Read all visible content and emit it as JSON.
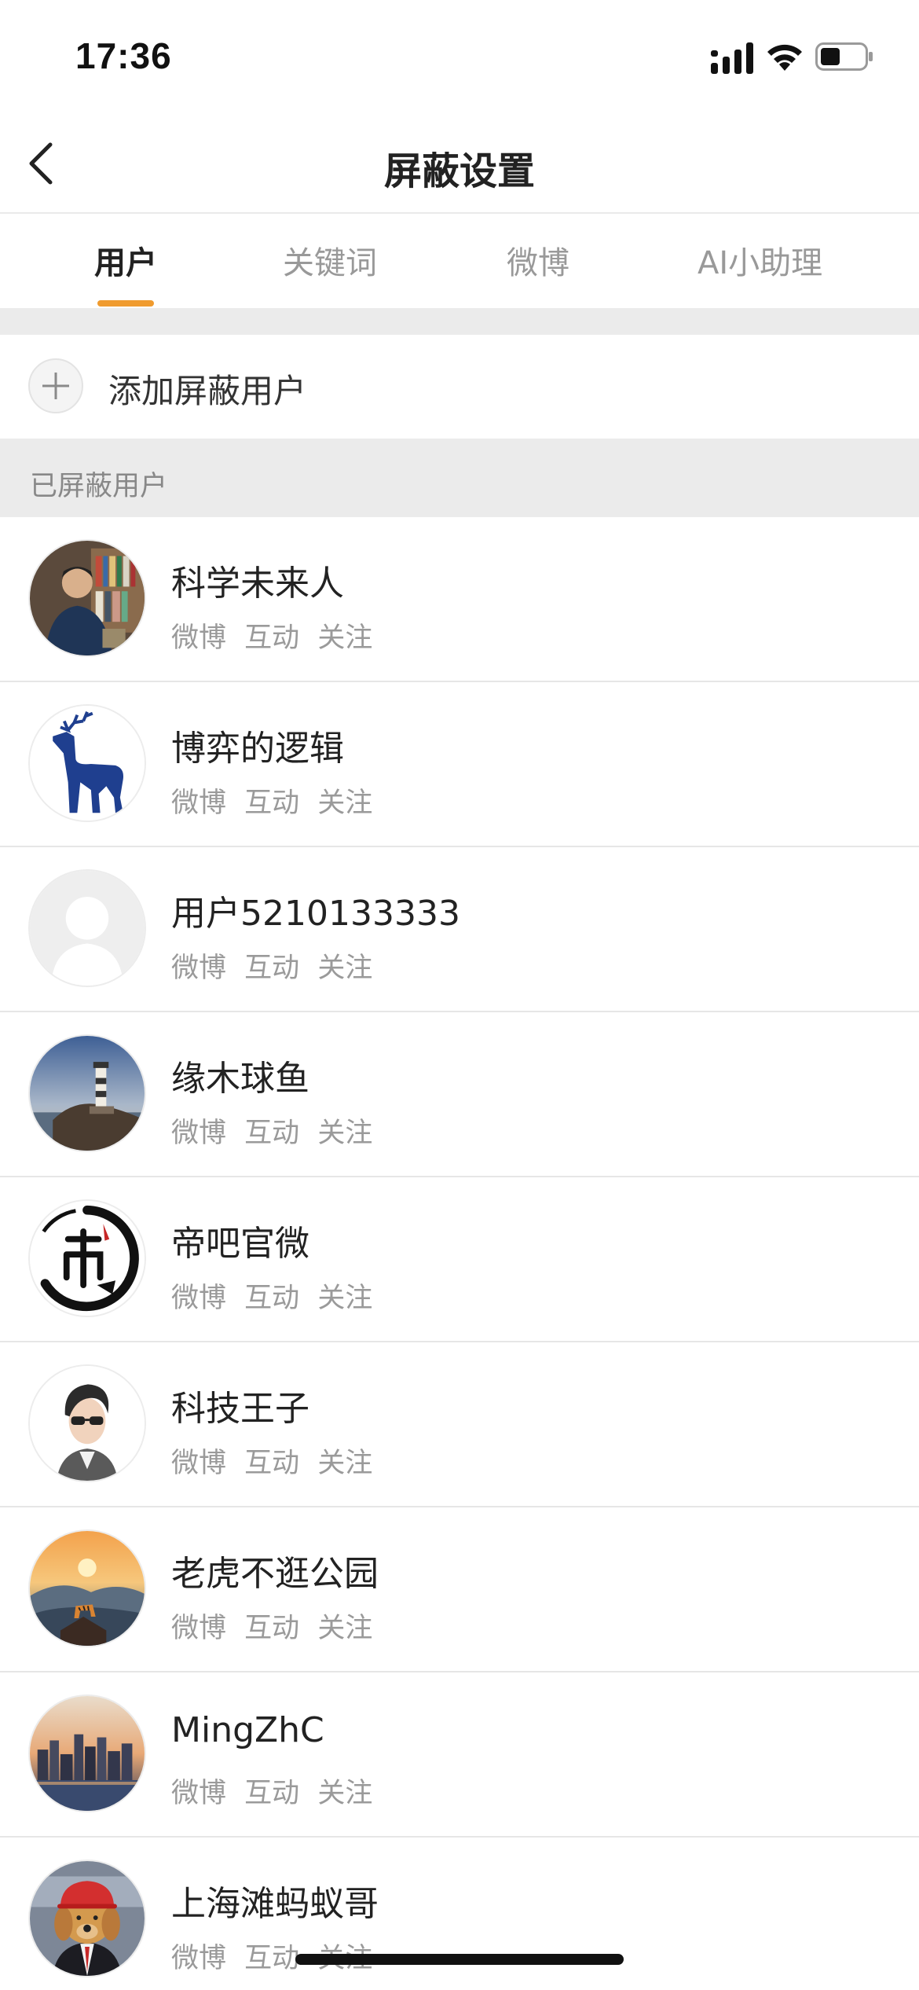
{
  "status_bar": {
    "time": "17:36"
  },
  "nav": {
    "title": "屏蔽设置"
  },
  "tabs": [
    {
      "label": "用户",
      "active": true
    },
    {
      "label": "关键词",
      "active": false
    },
    {
      "label": "微博",
      "active": false
    },
    {
      "label": "AI小助理",
      "active": false
    }
  ],
  "add_user": {
    "label": "添加屏蔽用户"
  },
  "section": {
    "title": "已屏蔽用户"
  },
  "actions": {
    "weibo": "微博",
    "interact": "互动",
    "follow": "关注"
  },
  "users": [
    {
      "name": "科学未来人",
      "avatar": "portrait-avatar"
    },
    {
      "name": "博弈的逻辑",
      "avatar": "deer-logo-avatar"
    },
    {
      "name": "用户5210133333",
      "avatar": "default-avatar"
    },
    {
      "name": "缘木球鱼",
      "avatar": "lighthouse-avatar"
    },
    {
      "name": "帝吧官微",
      "avatar": "calligraphy-logo-avatar"
    },
    {
      "name": "科技王子",
      "avatar": "cartoon-man-avatar"
    },
    {
      "name": "老虎不逛公园",
      "avatar": "tiger-sunset-avatar"
    },
    {
      "name": "MingZhC",
      "avatar": "city-skyline-avatar"
    },
    {
      "name": "上海滩蚂蚁哥",
      "avatar": "dog-helmet-avatar"
    }
  ],
  "colors": {
    "accent": "#f09b2e",
    "divider": "#ebebeb",
    "text_secondary": "#9a9a9a"
  }
}
